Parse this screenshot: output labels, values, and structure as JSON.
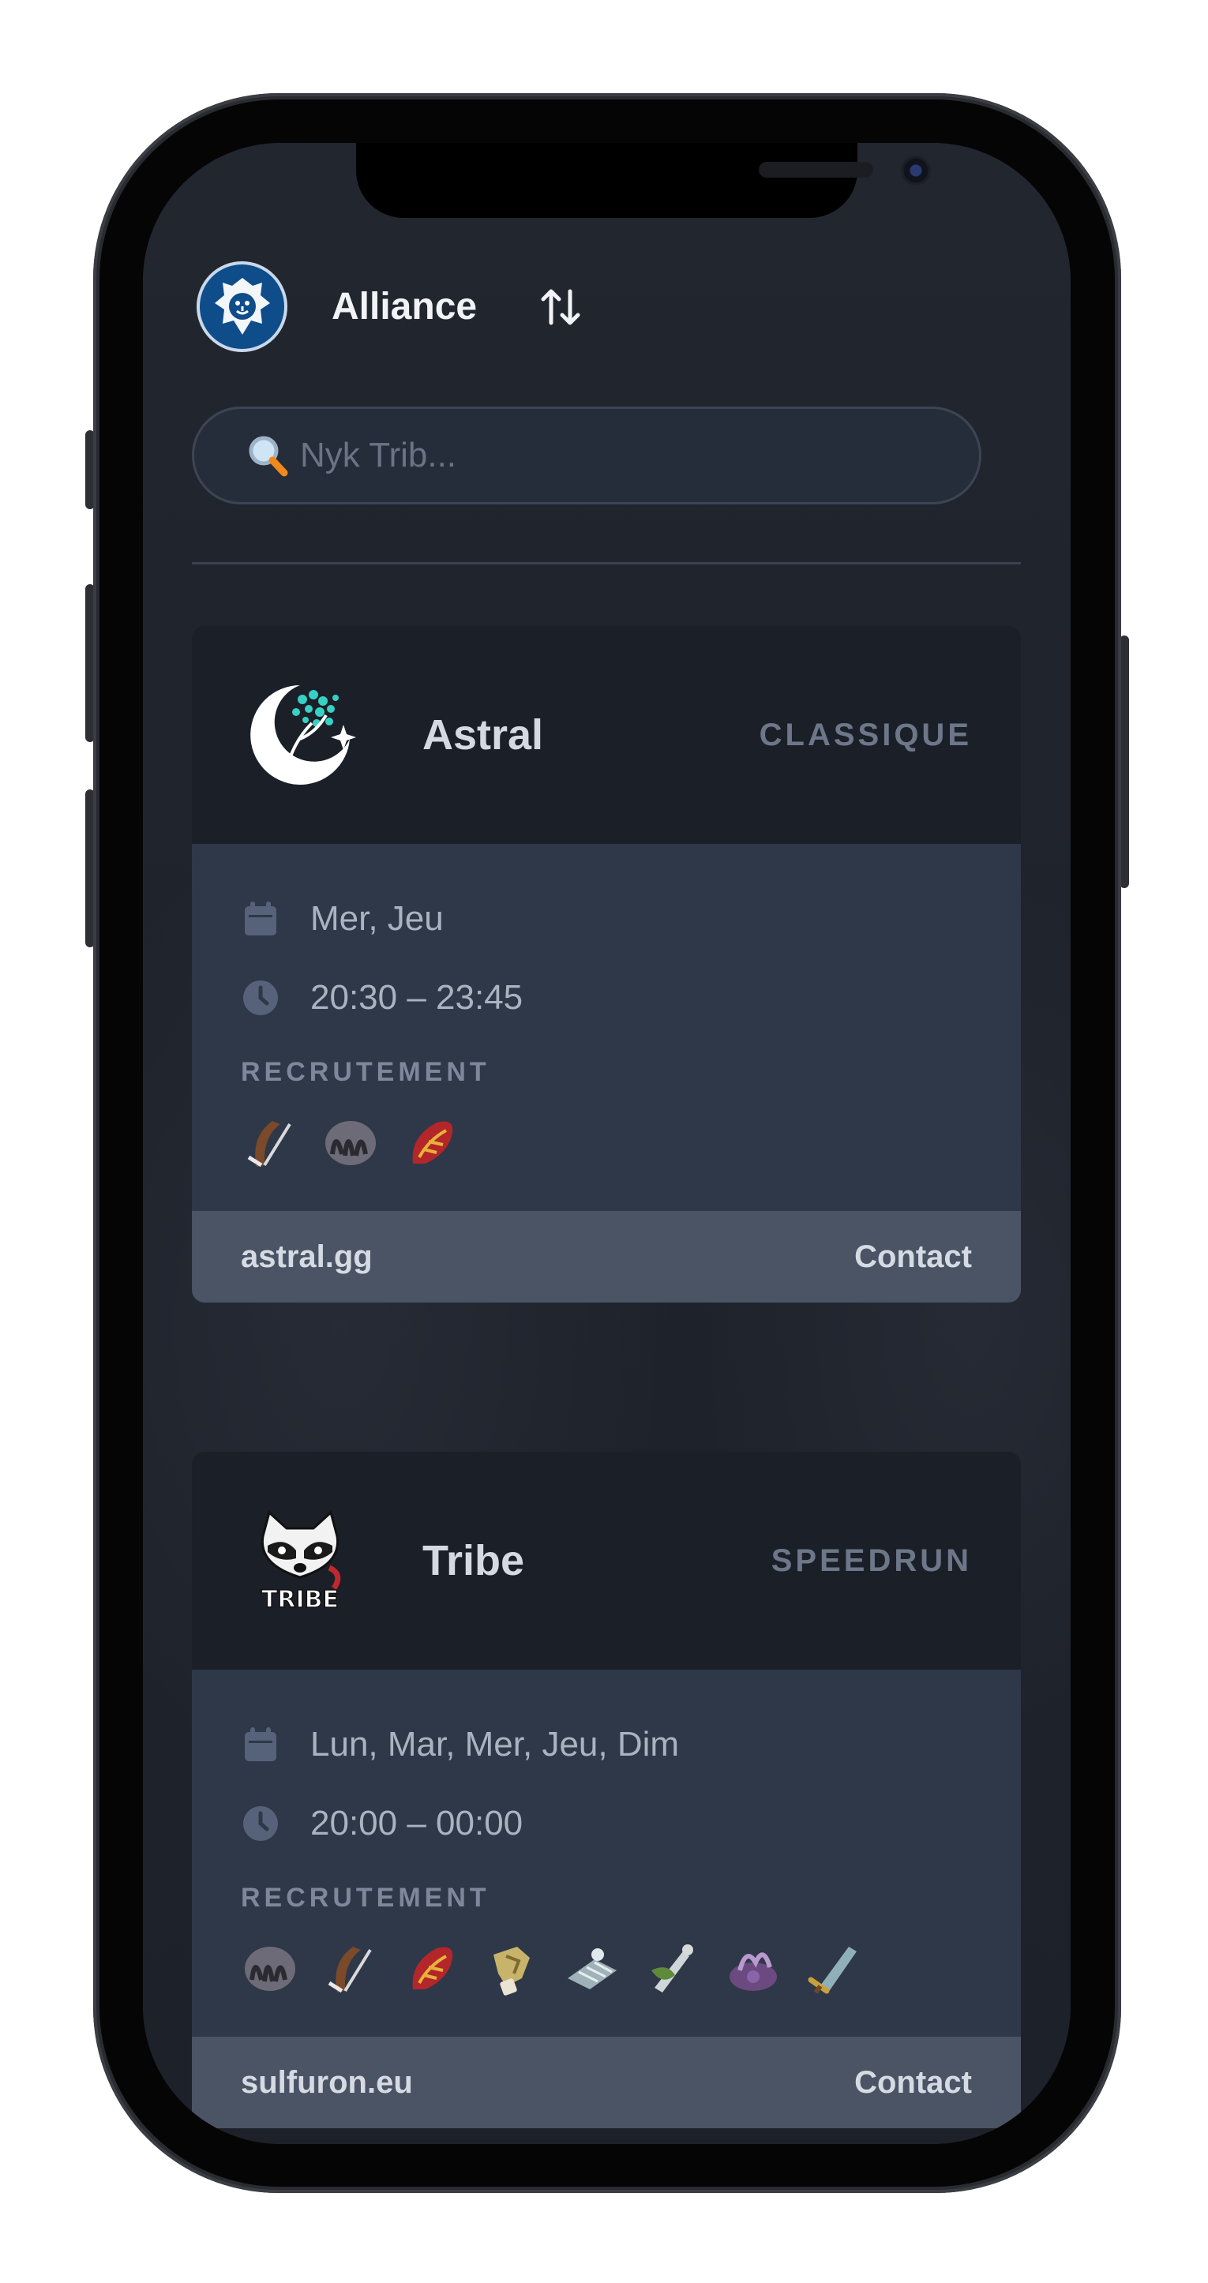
{
  "header": {
    "faction": "Alliance",
    "faction_icon": "lion-crest-icon",
    "sort_icon": "sort-arrows-icon"
  },
  "search": {
    "placeholder": "Nyk Trib...",
    "value": "",
    "icon": "magnifying-glass-icon"
  },
  "colors": {
    "screen_bg": "#1f232c",
    "card_head": "#1b1f28",
    "card_body": "#2e3848",
    "card_foot": "#4a5465",
    "faction_blue": "#0f4c8a"
  },
  "guilds": [
    {
      "name": "Astral",
      "mode": "CLASSIQUE",
      "logo": "moon-tree-logo",
      "days": "Mer, Jeu",
      "hours": "20:30 – 23:45",
      "recruit_label": "RECRUTEMENT",
      "classes": [
        "hunter-icon",
        "druid-icon",
        "mage-icon"
      ],
      "website": "astral.gg",
      "contact": "Contact"
    },
    {
      "name": "Tribe",
      "mode": "SPEEDRUN",
      "logo": "raccoon-tribe-logo",
      "days": "Lun, Mar, Mer, Jeu, Dim",
      "hours": "20:00 – 00:00",
      "recruit_label": "RECRUTEMENT",
      "classes": [
        "druid-icon",
        "hunter-icon",
        "mage-icon",
        "paladin-icon",
        "priest-icon",
        "rogue-icon",
        "warlock-icon",
        "warrior-icon"
      ],
      "website": "sulfuron.eu",
      "contact": "Contact"
    }
  ]
}
